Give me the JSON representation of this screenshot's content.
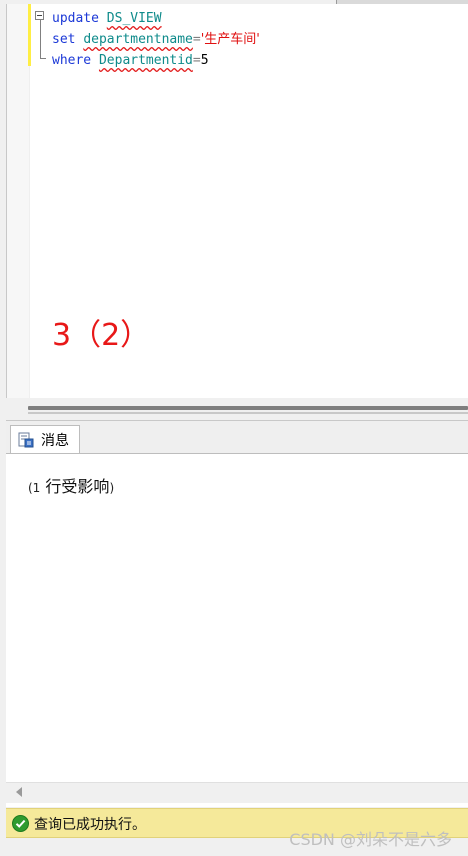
{
  "editor": {
    "lines": [
      {
        "keyword": "update",
        "identifier": "DS_VIEW"
      },
      {
        "keyword": "set",
        "identifier": "departmentname",
        "operator": "=",
        "string": "'生产车间'"
      },
      {
        "keyword": "where",
        "identifier": "Departmentid",
        "operator": "=",
        "number": "5"
      }
    ],
    "annotation": "3（2）"
  },
  "results": {
    "tab_label": "消息",
    "message_open": "(1",
    "message_text": "行受影响",
    "message_close": ")"
  },
  "status": {
    "text": "查询已成功执行。",
    "status_color": "#f5e99a"
  },
  "watermark": "CSDN @刘朵不是六多"
}
